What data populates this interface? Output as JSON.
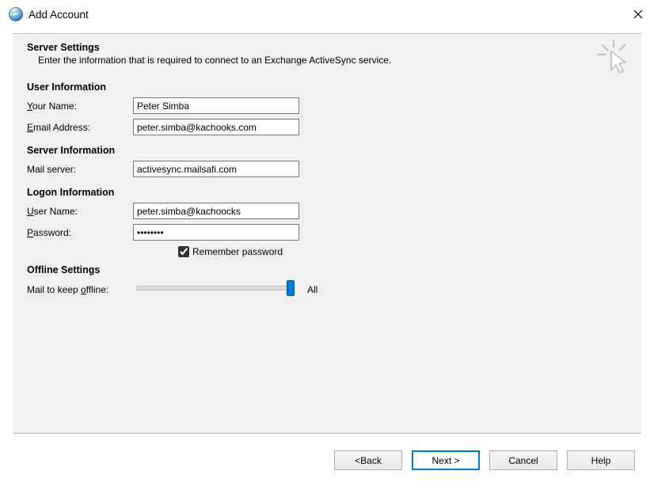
{
  "window": {
    "title": "Add Account"
  },
  "header": {
    "title": "Server Settings",
    "subtitle": "Enter the information that is required to connect to an Exchange ActiveSync service."
  },
  "sections": {
    "user_info": {
      "heading": "User Information",
      "your_name_label": "Your Name:",
      "your_name_value": "Peter Simba",
      "email_label": "Email Address:",
      "email_value": "peter.simba@kachooks.com"
    },
    "server_info": {
      "heading": "Server Information",
      "mail_server_label": "Mail server:",
      "mail_server_value": "activesync.mailsafi.com"
    },
    "logon_info": {
      "heading": "Logon Information",
      "user_name_label": "User Name:",
      "user_name_value": "peter.simba@kachoocks",
      "password_label": "Password:",
      "password_value": "••••••••",
      "remember_label": "Remember password",
      "remember_checked": true
    },
    "offline": {
      "heading": "Offline Settings",
      "slider_label": "Mail to keep offline:",
      "slider_value_label": "All"
    }
  },
  "buttons": {
    "back": "< Back",
    "next": "Next >",
    "cancel": "Cancel",
    "help": "Help"
  }
}
